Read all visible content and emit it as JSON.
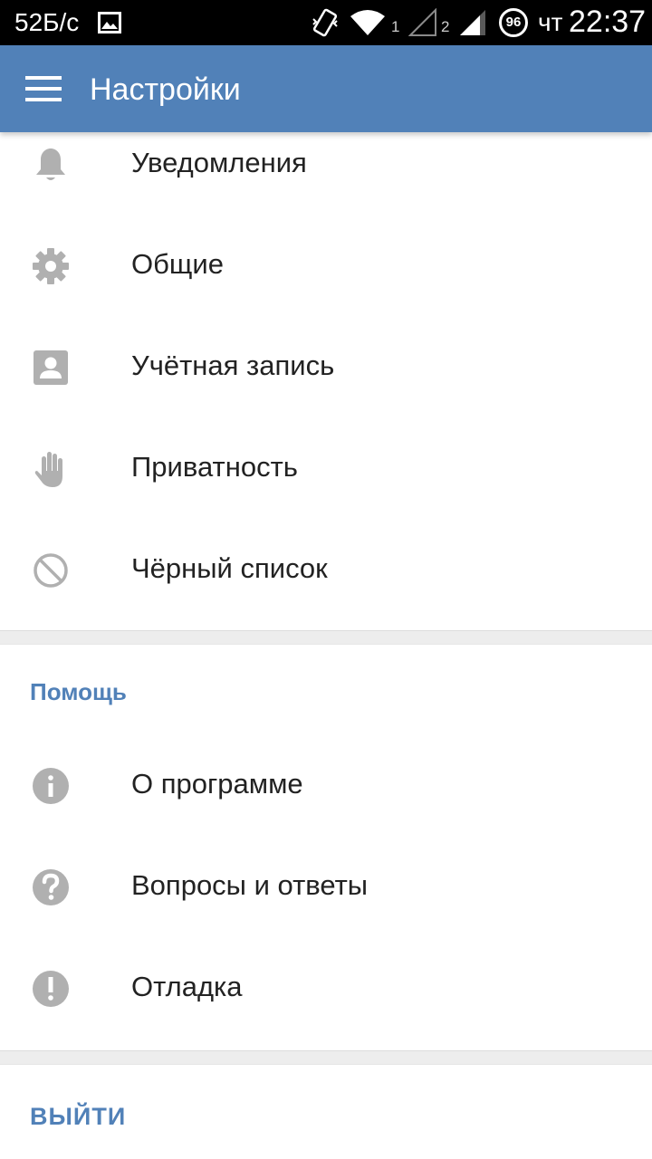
{
  "status_bar": {
    "net_speed": "52Б/с",
    "sim1": "1",
    "sim2": "2",
    "battery": "96",
    "day": "чт",
    "time": "22:37"
  },
  "app_bar": {
    "title": "Настройки"
  },
  "settings_items": [
    {
      "icon": "bell-icon",
      "label": "Уведомления"
    },
    {
      "icon": "gear-icon",
      "label": "Общие"
    },
    {
      "icon": "account-icon",
      "label": "Учётная запись"
    },
    {
      "icon": "hand-icon",
      "label": "Приватность"
    },
    {
      "icon": "block-icon",
      "label": "Чёрный список"
    }
  ],
  "help_section": {
    "header": "Помощь",
    "items": [
      {
        "icon": "info-icon",
        "label": "О программе"
      },
      {
        "icon": "question-icon",
        "label": "Вопросы и ответы"
      },
      {
        "icon": "exclamation-icon",
        "label": "Отладка"
      }
    ]
  },
  "logout_label": "ВЫЙТИ",
  "colors": {
    "accent": "#5181b8",
    "icon_gray": "#b0b0b0",
    "separator": "#ededed"
  }
}
